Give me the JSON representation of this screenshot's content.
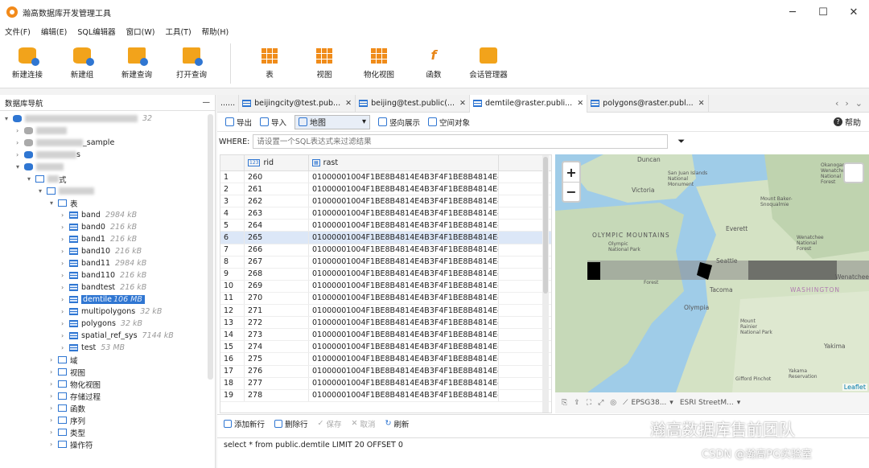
{
  "app": {
    "title": "瀚高数据库开发管理工具",
    "window_buttons": [
      "─",
      "☐",
      "✕"
    ]
  },
  "menu": [
    "文件(F)",
    "编辑(E)",
    "SQL编辑器",
    "窗口(W)",
    "工具(T)",
    "帮助(H)"
  ],
  "toolbar": {
    "new_connection": "新建连接",
    "new_group": "新建组",
    "new_query": "新建查询",
    "open_query": "打开查询",
    "table": "表",
    "view": "视图",
    "mat_view": "物化视图",
    "function": "函数",
    "session_manager": "会话管理器"
  },
  "navigator": {
    "title": "数据库导航",
    "minimize": "—",
    "conn_suffix": "32",
    "sample_suffix": "_sample",
    "s_suffix": "s",
    "schema_suffix": "式",
    "tables_folder": "表",
    "tables": [
      {
        "name": "band",
        "size": "2984 kB"
      },
      {
        "name": "band0",
        "size": "216 kB"
      },
      {
        "name": "band1",
        "size": "216 kB"
      },
      {
        "name": "band10",
        "size": "216 kB"
      },
      {
        "name": "band11",
        "size": "2984 kB"
      },
      {
        "name": "band110",
        "size": "216 kB"
      },
      {
        "name": "bandtest",
        "size": "216 kB"
      },
      {
        "name": "demtile",
        "size": "106 MB"
      },
      {
        "name": "multipolygons",
        "size": "32 kB"
      },
      {
        "name": "polygons",
        "size": "32 kB"
      },
      {
        "name": "spatial_ref_sys",
        "size": "7144 kB"
      },
      {
        "name": "test",
        "size": "53 MB"
      }
    ],
    "folders": [
      "域",
      "视图",
      "物化视图",
      "存储过程",
      "函数",
      "序列",
      "类型",
      "操作符"
    ]
  },
  "tabs": [
    {
      "label": "......"
    },
    {
      "label": "beijingcity@test.pub..."
    },
    {
      "label": "beijing@test.public(..."
    },
    {
      "label": "demtile@raster.publi..."
    },
    {
      "label": "polygons@raster.publ..."
    }
  ],
  "tab_nav": [
    "‹",
    "›",
    "⌄"
  ],
  "subtoolbar": {
    "export": "导出",
    "import": "导入",
    "mode": "地图",
    "vertical": "竖向展示",
    "spatial": "空间对象",
    "help": "帮助"
  },
  "where": {
    "label": "WHERE:",
    "placeholder": "请设置一个SQL表达式来过滤结果"
  },
  "grid": {
    "columns": [
      {
        "type": "123",
        "name": "rid"
      },
      {
        "type": "▦",
        "name": "rast"
      }
    ],
    "rows": [
      {
        "n": "1",
        "rid": "260",
        "rast": "01000001004F1BE8B4814E4B3F4F1BE8B4814E4B..."
      },
      {
        "n": "2",
        "rid": "261",
        "rast": "01000001004F1BE8B4814E4B3F4F1BE8B4814E4B..."
      },
      {
        "n": "3",
        "rid": "262",
        "rast": "01000001004F1BE8B4814E4B3F4F1BE8B4814E4B..."
      },
      {
        "n": "4",
        "rid": "263",
        "rast": "01000001004F1BE8B4814E4B3F4F1BE8B4814E4B..."
      },
      {
        "n": "5",
        "rid": "264",
        "rast": "01000001004F1BE8B4814E4B3F4F1BE8B4814E4B..."
      },
      {
        "n": "6",
        "rid": "265",
        "rast": "01000001004F1BE8B4814E4B3F4F1BE8B4814E4B..."
      },
      {
        "n": "7",
        "rid": "266",
        "rast": "01000001004F1BE8B4814E4B3F4F1BE8B4814E4B..."
      },
      {
        "n": "8",
        "rid": "267",
        "rast": "01000001004F1BE8B4814E4B3F4F1BE8B4814E4B..."
      },
      {
        "n": "9",
        "rid": "268",
        "rast": "01000001004F1BE8B4814E4B3F4F1BE8B4814E4B..."
      },
      {
        "n": "10",
        "rid": "269",
        "rast": "01000001004F1BE8B4814E4B3F4F1BE8B4814E4B..."
      },
      {
        "n": "11",
        "rid": "270",
        "rast": "01000001004F1BE8B4814E4B3F4F1BE8B4814E4B..."
      },
      {
        "n": "12",
        "rid": "271",
        "rast": "01000001004F1BE8B4814E4B3F4F1BE8B4814E4B..."
      },
      {
        "n": "13",
        "rid": "272",
        "rast": "01000001004F1BE8B4814E4B3F4F1BE8B4814E4B..."
      },
      {
        "n": "14",
        "rid": "273",
        "rast": "01000001004F1BE8B4814E4B3F4F1BE8B4814E4B..."
      },
      {
        "n": "15",
        "rid": "274",
        "rast": "01000001004F1BE8B4814E4B3F4F1BE8B4814E4B..."
      },
      {
        "n": "16",
        "rid": "275",
        "rast": "01000001004F1BE8B4814E4B3F4F1BE8B4814E4B..."
      },
      {
        "n": "17",
        "rid": "276",
        "rast": "01000001004F1BE8B4814E4B3F4F1BE8B4814E4B..."
      },
      {
        "n": "18",
        "rid": "277",
        "rast": "01000001004F1BE8B4814E4B3F4F1BE8B4814E4B..."
      },
      {
        "n": "19",
        "rid": "278",
        "rast": "01000001004F1BE8B4814E4B3F4F1BE8B4814E4B..."
      }
    ],
    "selected_row": 6
  },
  "map": {
    "zoom_in": "+",
    "zoom_out": "−",
    "attribution": "Leaflet",
    "labels": [
      "Duncan",
      "San Juan Islands National Monument",
      "Victoria",
      "OLYMPIC MOUNTAINS",
      "Olympic National Park",
      "Everett",
      "Seattle",
      "Tacoma",
      "Olympia",
      "Wenatchee",
      "WASHINGTON",
      "Yakima",
      "Mount Rainier National Park",
      "Gifford Pinchot",
      "Wenatchee National Forest",
      "Okanogan-Wenatchee National Forest",
      "Mount Baker-Snoqualmie",
      "Yakama Reservation",
      "Forest"
    ],
    "crs": "EPSG38...",
    "basemap": "ESRI StreetM..."
  },
  "actions": {
    "add_row": "添加新行",
    "delete_row": "删除行",
    "save": "保存",
    "cancel": "取消",
    "refresh": "刷新"
  },
  "sql": "select * from public.demtile  LIMIT 20 OFFSET 0",
  "watermarks": {
    "wechat": "瀚高数据库售前团队",
    "csdn": "CSDN @瀚高PG实验室"
  },
  "colors": {
    "accent": "#2f76d2",
    "orange": "#f2a31b"
  }
}
